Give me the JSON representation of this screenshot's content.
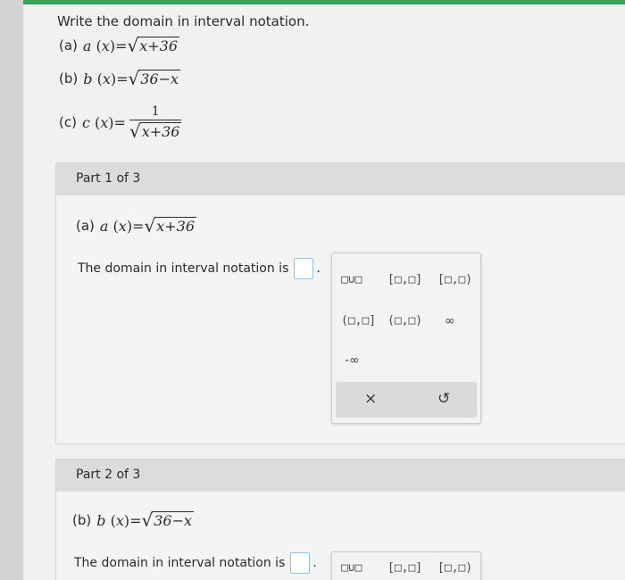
{
  "question": {
    "title": "Write the domain in interval notation.",
    "problems": [
      {
        "label": "(a)",
        "func": "a",
        "var": "x",
        "sqrt_arg": "x+36"
      },
      {
        "label": "(b)",
        "func": "b",
        "var": "x",
        "sqrt_arg": "36−x"
      },
      {
        "label": "(c)",
        "func": "c",
        "var": "x",
        "numerator": "1",
        "sqrt_arg": "x+36"
      }
    ]
  },
  "parts": [
    {
      "header": "Part 1 of 3",
      "label": "(a)",
      "func": "a",
      "var": "x",
      "sqrt_arg": "x+36",
      "answer_prompt": "The domain in interval notation is",
      "answer_value": ""
    },
    {
      "header": "Part 2 of 3",
      "label": "(b)",
      "func": "b",
      "var": "x",
      "sqrt_arg": "36−x",
      "answer_prompt": "The domain in interval notation is",
      "answer_value": ""
    }
  ],
  "keypad": {
    "keys": [
      "□∪□",
      "[□,□]",
      "[□,□)",
      "(□,□]",
      "(□,□)",
      "∞",
      "-∞"
    ],
    "actions": {
      "clear": "×",
      "undo": "↺"
    }
  }
}
